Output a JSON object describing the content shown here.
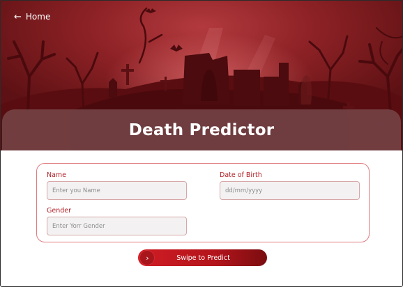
{
  "header": {
    "back_label": "Home",
    "title": "Death Predictor"
  },
  "form": {
    "name": {
      "label": "Name",
      "placeholder": "Enter you Name",
      "value": ""
    },
    "dob": {
      "label": "Date of Birth",
      "placeholder": "dd/mm/yyyy",
      "value": ""
    },
    "gender": {
      "label": "Gender",
      "placeholder": "Enter Yorr Gender",
      "value": ""
    }
  },
  "action": {
    "swipe_label": "Swipe to Predict"
  },
  "colors": {
    "accent": "#b01e24",
    "hero_bg": "#8e2226",
    "band": "#78484a"
  },
  "icons": {
    "back": "arrow-left-icon",
    "swipe": "chevron-right-icon"
  }
}
